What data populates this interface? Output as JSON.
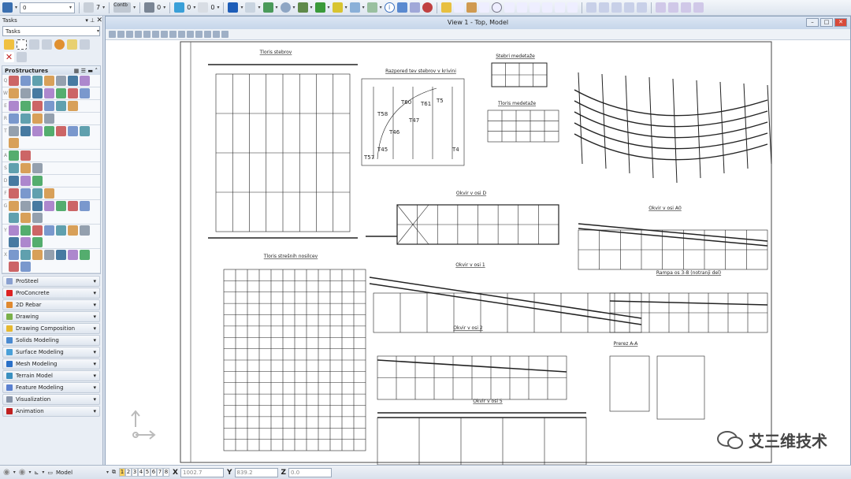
{
  "toolbar": {
    "level_value": "0",
    "color_value": "7",
    "linestyle_value": "Contb",
    "weight_value": "0",
    "transparency_value": "0",
    "priority_value": "0"
  },
  "tasks_panel": {
    "title": "Tasks",
    "combo_value": "Tasks",
    "prostructures_title": "ProStructures",
    "row_keys": [
      "Q",
      "W",
      "E",
      "R",
      "T",
      "A",
      "S",
      "D",
      "F",
      "G",
      "Y",
      "X"
    ],
    "sections": [
      {
        "label": "ProSteel",
        "color": "#8aa0d0"
      },
      {
        "label": "ProConcrete",
        "color": "#d22"
      },
      {
        "label": "2D Rebar",
        "color": "#e08a30"
      },
      {
        "label": "Drawing",
        "color": "#7ab04a"
      },
      {
        "label": "Drawing Composition",
        "color": "#e6b830"
      },
      {
        "label": "Solids Modeling",
        "color": "#4a8ad0"
      },
      {
        "label": "Surface Modeling",
        "color": "#4aa0d8"
      },
      {
        "label": "Mesh Modeling",
        "color": "#2a70c8"
      },
      {
        "label": "Terrain Model",
        "color": "#3a90c0"
      },
      {
        "label": "Feature Modeling",
        "color": "#5a80d0"
      },
      {
        "label": "Visualization",
        "color": "#8894a8"
      },
      {
        "label": "Animation",
        "color": "#c02020"
      }
    ]
  },
  "view": {
    "title": "View 1 - Top, Model",
    "drawing_titles": {
      "t1": "Tloris stebrov",
      "t2": "Razpored tev stebrov v krivini",
      "t3": "Stebri medetaže",
      "t4": "Tloris medetaže",
      "t5": "Okvir v osi D",
      "t6": "Okvir v osi A0",
      "t7": "Tloris strešnih nosilcev",
      "t8": "Okvir v osi 1",
      "t9": "Rampa os 3-8 (notranji del)",
      "t10": "Okvir v osi 2",
      "t11": "Prerez A-A",
      "t12": "Okvir v osi 5"
    },
    "column_labels": [
      "T57",
      "T45",
      "T46",
      "T47",
      "T58",
      "T60",
      "T61",
      "T5",
      "T4"
    ]
  },
  "status": {
    "model_label": "Model",
    "views": [
      "1",
      "2",
      "3",
      "4",
      "5",
      "6",
      "7",
      "8"
    ],
    "active_view": "1",
    "x_label": "X",
    "x_value": "1002.7",
    "y_label": "Y",
    "y_value": "839.2",
    "z_label": "Z",
    "z_value": "0.0"
  },
  "watermark": "艾三维技术"
}
